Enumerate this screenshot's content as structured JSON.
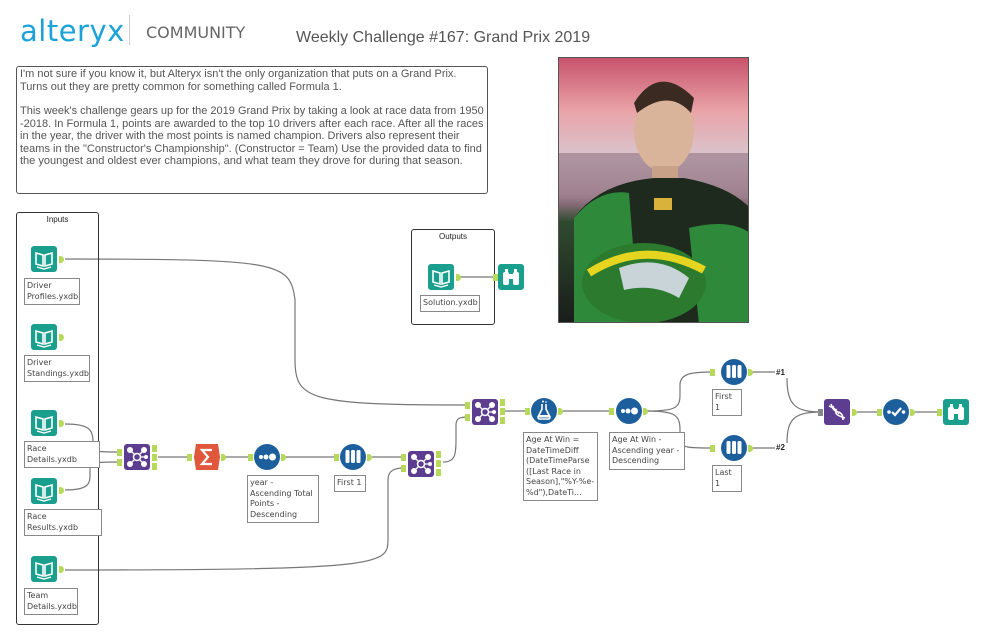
{
  "header": {
    "logo": "alteryx",
    "community": "COMMUNITY",
    "title": "Weekly Challenge #167: Grand Prix 2019"
  },
  "description": {
    "paragraph1": "I'm not sure if you know it, but Alteryx isn't the only organization that puts on a Grand Prix. Turns out they are pretty common for something called Formula 1.",
    "paragraph2": "This week's challenge gears up for the 2019 Grand Prix by taking a look at race data from 1950 -2018. In Formula 1, points are awarded to the top 10 drivers after each race. After all the races in the year, the driver with the most points is named champion. Drivers also represent their teams in the \"Constructor's Championship\". (Constructor = Team) Use the provided data to find the youngest and oldest ever champions, and what team they drove for during that season."
  },
  "containers": {
    "inputs": "Inputs",
    "outputs": "Outputs"
  },
  "inputs": [
    {
      "label": "Driver Profiles.yxdb",
      "icon": "book-icon"
    },
    {
      "label": "Driver Standings.yxdb",
      "icon": "book-icon"
    },
    {
      "label": "Race Details.yxdb",
      "icon": "book-icon"
    },
    {
      "label": "Race Results.yxdb",
      "icon": "book-icon"
    },
    {
      "label": "Team Details.yxdb",
      "icon": "book-icon"
    }
  ],
  "outputs": {
    "solution": "Solution.yxdb"
  },
  "tools": {
    "sort1": "year - Ascending Total Points - Descending",
    "sample1": "First 1",
    "formula": "Age At Win = DateTimeDiff (DateTimeParse ([Last Race in Season],\"%Y-%e-%d\"),DateTi...",
    "sort2": "Age At Win - Ascending year - Descending",
    "sample_first": "First 1",
    "sample_last": "Last 1"
  },
  "union_tags": [
    "#1",
    "#2"
  ],
  "join_anchors": [
    "L",
    "J",
    "R"
  ],
  "colors": {
    "brand": "#1ba3d9",
    "input_tool": "#1a9e8e",
    "join_tool": "#5c3d8f",
    "summarize_tool": "#e0573c",
    "preparation_tool": "#1d5f9c",
    "anchor": "#b6d95a"
  }
}
